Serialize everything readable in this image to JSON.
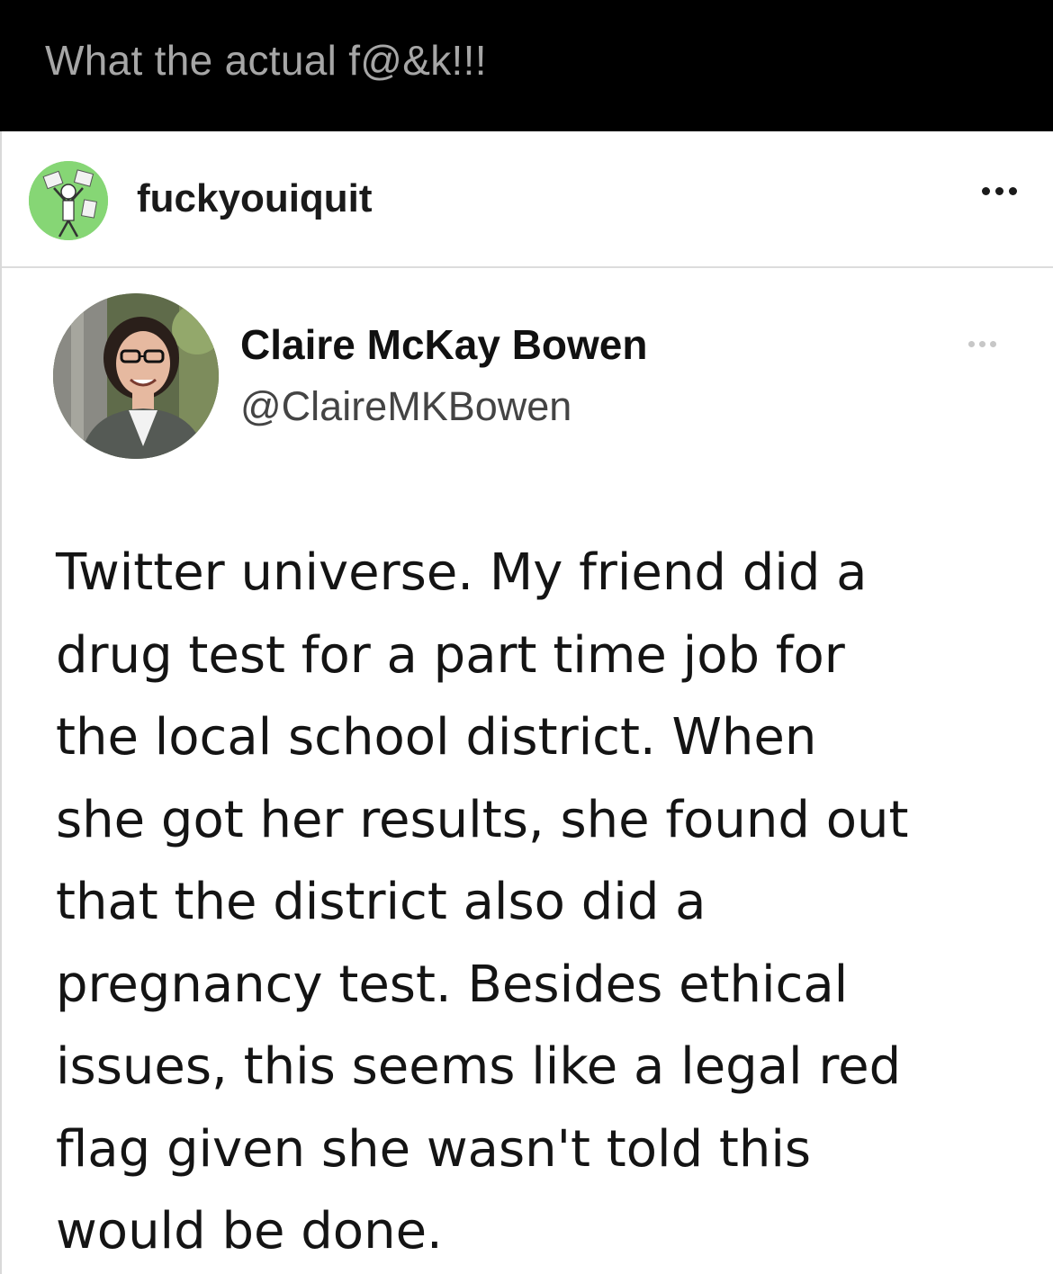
{
  "caption": {
    "text": "What the actual f@&k!!!"
  },
  "post": {
    "username": "fuckyouiquit",
    "more_icon": "more-horizontal-icon"
  },
  "tweet": {
    "name": "Claire McKay Bowen",
    "handle": "@ClaireMKBowen",
    "more_icon": "more-horizontal-icon",
    "lines": [
      "Twitter universe. My friend did a",
      "drug test for a part time job for",
      "the local school district. When",
      "she got her results, she found out",
      "that the district also did a",
      "pregnancy test. Besides ethical",
      "issues, this seems like a legal red",
      "flag given she wasn't told this",
      "would be done."
    ]
  },
  "colors": {
    "caption_bg": "#000000",
    "caption_text": "#a6a6a6",
    "post_bg": "#ffffff",
    "avatar_bg": "#7fd36e",
    "text": "#141414"
  }
}
